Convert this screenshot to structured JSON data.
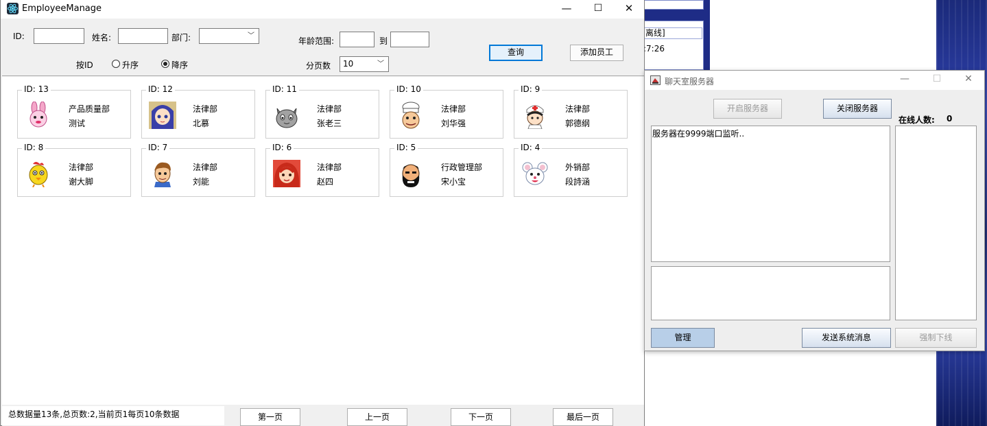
{
  "background": {
    "line1": "离线]",
    "line2": ":7:26"
  },
  "employee_window": {
    "title": "EmployeeManage",
    "controls": {
      "minimize": "—",
      "maximize": "☐",
      "close": "✕"
    },
    "form": {
      "id_label": "ID:",
      "name_label": "姓名:",
      "dept_label": "部门:",
      "dept_value": "",
      "age_label": "年龄范围:",
      "age_to": "到",
      "sort_label": "按ID",
      "asc_label": "升序",
      "desc_label": "降序",
      "sort_selected": "desc",
      "page_size_label": "分页数",
      "page_size_value": "10",
      "query_button": "查询",
      "add_button": "添加员工"
    },
    "cards": [
      {
        "id": "ID: 13",
        "dept": "产品质量部",
        "name": "测试",
        "avatar": "pink-rabbit"
      },
      {
        "id": "ID: 12",
        "dept": "法律部",
        "name": "北慕",
        "avatar": "blue-hair-girl"
      },
      {
        "id": "ID: 11",
        "dept": "法律部",
        "name": "张老三",
        "avatar": "grey-cat"
      },
      {
        "id": "ID: 10",
        "dept": "法律部",
        "name": "刘华强",
        "avatar": "chef"
      },
      {
        "id": "ID: 9",
        "dept": "法律部",
        "name": "郭德纲",
        "avatar": "nurse"
      },
      {
        "id": "ID: 8",
        "dept": "法律部",
        "name": "谢大脚",
        "avatar": "yellow-chick"
      },
      {
        "id": "ID: 7",
        "dept": "法律部",
        "name": "刘能",
        "avatar": "brown-hair-boy"
      },
      {
        "id": "ID: 6",
        "dept": "法律部",
        "name": "赵四",
        "avatar": "red-hair-girl"
      },
      {
        "id": "ID: 5",
        "dept": "行政管理部",
        "name": "宋小宝",
        "avatar": "bearded-man"
      },
      {
        "id": "ID: 4",
        "dept": "外销部",
        "name": "段詩涵",
        "avatar": "white-mouse"
      }
    ],
    "footer": {
      "status": "总数据量13条,总页数:2,当前页1每页10条数据",
      "first": "第一页",
      "prev": "上一页",
      "next": "下一页",
      "last": "最后一页"
    }
  },
  "chat_window": {
    "title": "聊天室服务器",
    "controls": {
      "minimize": "—",
      "maximize": "☐",
      "close": "✕"
    },
    "start_button": "开启服务器",
    "stop_button": "关闭服务器",
    "online_label": "在线人数:",
    "online_count": "0",
    "log_text": "服务器在9999端口监听..",
    "message_input": "",
    "manage_button": "管理",
    "send_button": "发送系统消息",
    "kick_button": "强制下线"
  }
}
